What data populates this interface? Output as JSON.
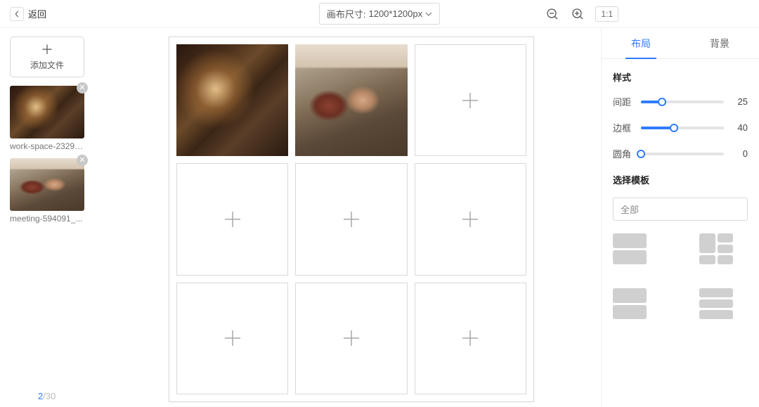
{
  "header": {
    "back_label": "返回",
    "canvas_size_prefix": "画布尺寸:",
    "canvas_size_value": "1200*1200px",
    "ratio_label": "1:1"
  },
  "sidebar": {
    "add_file_label": "添加文件",
    "thumbs": [
      {
        "name": "work-space-23298..."
      },
      {
        "name": "meeting-594091_..."
      }
    ],
    "counter": {
      "current": "2",
      "total": "30"
    }
  },
  "right": {
    "tabs": {
      "layout": "布局",
      "background": "背景"
    },
    "style_title": "样式",
    "sliders": [
      {
        "label": "间距",
        "value": 25,
        "min": 0,
        "max": 100
      },
      {
        "label": "边框",
        "value": 40,
        "min": 0,
        "max": 100
      },
      {
        "label": "圆角",
        "value": 0,
        "min": 0,
        "max": 100
      }
    ],
    "template_title": "选择模板",
    "template_filter": "全部"
  }
}
